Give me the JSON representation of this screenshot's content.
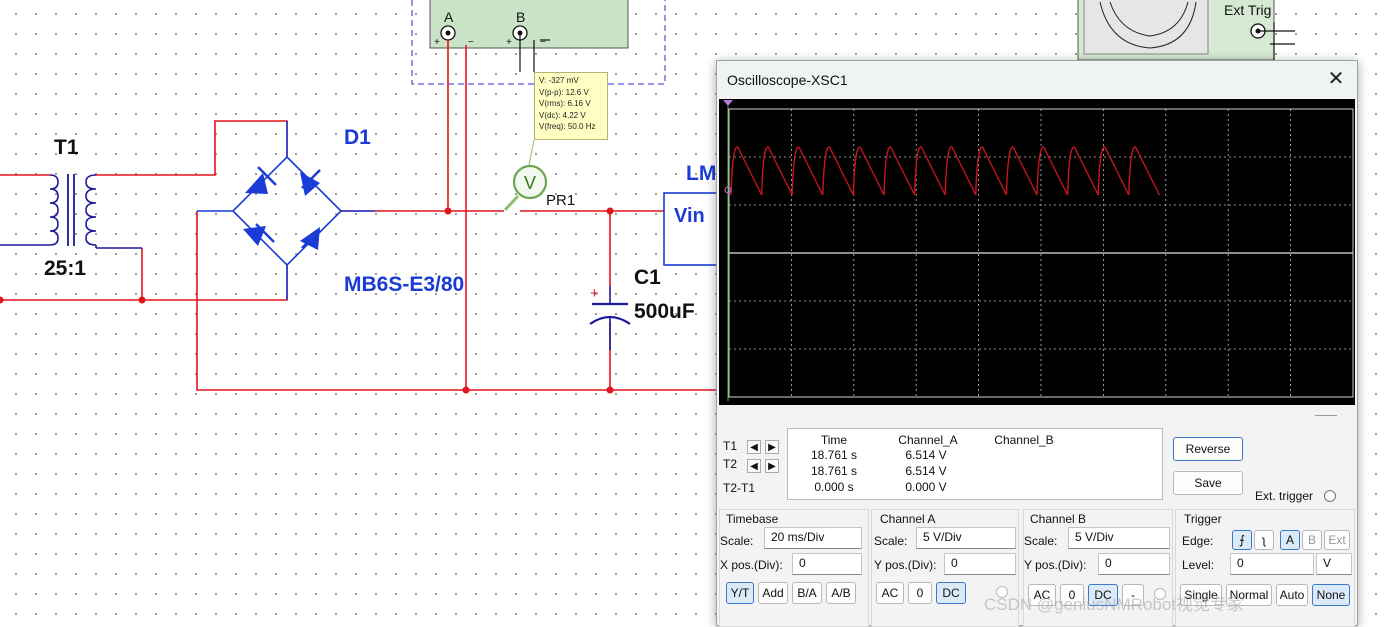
{
  "schematic": {
    "transformer_ref": "T1",
    "transformer_ratio": "25:1",
    "bridge_ref": "D1",
    "bridge_part": "MB6S-E3/80",
    "capacitor_ref": "C1",
    "capacitor_value": "500uF",
    "capacitor_polarity": "+",
    "probe_ref": "PR1",
    "probe_symbol": "V",
    "regulator_ref_partial": "LM",
    "regulator_pin": "Vin",
    "multimeter_terminal_a": "A",
    "multimeter_terminal_b": "B",
    "ext_trig_label": "Ext Trig",
    "wire_color": "#e3141b",
    "component_color": "#1a3bd6"
  },
  "probe_tooltip": {
    "v": "V: -327 mV",
    "vpp": "V(p-p): 12.6 V",
    "vrms": "V(rms): 6.16 V",
    "vdc": "V(dc): 4.22 V",
    "vfreq": "V(freq): 50.0 Hz"
  },
  "oscilloscope": {
    "title": "Oscilloscope-XSC1",
    "close_icon": "close-icon",
    "trace_color": "#c8141e",
    "readout": {
      "t1_label": "T1",
      "t2_label": "T2",
      "diff_label": "T2-T1",
      "headers": [
        "Time",
        "Channel_A",
        "Channel_B"
      ],
      "rows": [
        [
          "18.761 s",
          "6.514 V",
          ""
        ],
        [
          "18.761 s",
          "6.514 V",
          ""
        ],
        [
          "0.000 s",
          "0.000 V",
          ""
        ]
      ]
    },
    "buttons": {
      "reverse": "Reverse",
      "save": "Save",
      "ext_trigger": "Ext. trigger"
    },
    "timebase": {
      "title": "Timebase",
      "scale_label": "Scale:",
      "scale_value": "20 ms/Div",
      "xpos_label": "X pos.(Div):",
      "xpos_value": "0",
      "modes": [
        "Y/T",
        "Add",
        "B/A",
        "A/B"
      ],
      "selected_mode": "Y/T"
    },
    "channel_a": {
      "title": "Channel A",
      "scale_label": "Scale:",
      "scale_value": "5  V/Div",
      "ypos_label": "Y pos.(Div):",
      "ypos_value": "0",
      "coupling": [
        "AC",
        "0",
        "DC"
      ],
      "selected_coupling": "DC"
    },
    "channel_b": {
      "title": "Channel B",
      "scale_label": "Scale:",
      "scale_value": "5  V/Div",
      "ypos_label": "Y pos.(Div):",
      "ypos_value": "0",
      "coupling": [
        "AC",
        "0",
        "DC",
        "-"
      ],
      "selected_coupling": "DC"
    },
    "trigger": {
      "title": "Trigger",
      "edge_label": "Edge:",
      "sources": [
        "A",
        "B",
        "Ext"
      ],
      "selected_source": "A",
      "level_label": "Level:",
      "level_value": "0",
      "level_unit": "V",
      "modes": [
        "Single",
        "Normal",
        "Auto",
        "None"
      ],
      "selected_mode": "None"
    }
  },
  "watermark": "CSDN @geniusNMRobot视觉专家"
}
